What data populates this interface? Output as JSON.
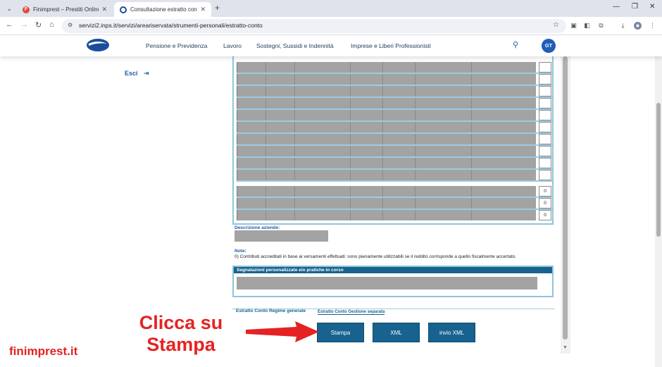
{
  "browser": {
    "tabs": [
      {
        "title": "Finimprest – Prestiti Online | Fi",
        "active": false
      },
      {
        "title": "Consultazione estratto conto",
        "active": true
      }
    ],
    "url": "servizi2.inps.it/servizi/areariservata/strumenti-personali/estratto-conto"
  },
  "header": {
    "nav": [
      "Pensione e Previdenza",
      "Lavoro",
      "Sostegni, Sussidi e Indennità",
      "Imprese e Liberi Professionisti"
    ],
    "avatar": "GT"
  },
  "sidebar": {
    "logout": "Esci"
  },
  "table": {
    "rows": [
      "",
      "",
      "",
      "",
      "",
      "",
      "",
      "",
      "",
      "",
      "0",
      "0",
      "0"
    ]
  },
  "desc_label": "Descrizione aziende:",
  "notes": {
    "label": "Note:",
    "text": "0) Contributi accreditati in base ai versamenti effettuati: sono pienamente utilizzabili se il reddito corrisponde a quello fiscalmente accertato."
  },
  "signals_title": "Segnalazioni personalizzate e/o pratiche in corso",
  "subtabs": [
    "Estratto Conto Regime generale",
    "Estratto Conto Gestione separata"
  ],
  "buttons": {
    "print": "Stampa",
    "xml": "XML",
    "send_xml": "invio XML"
  },
  "callout": "Clicca su Stampa",
  "brand": "finimprest.it",
  "colors": {
    "accent": "#17628f",
    "callout": "#e52222",
    "avatar": "#1f5fb7"
  }
}
